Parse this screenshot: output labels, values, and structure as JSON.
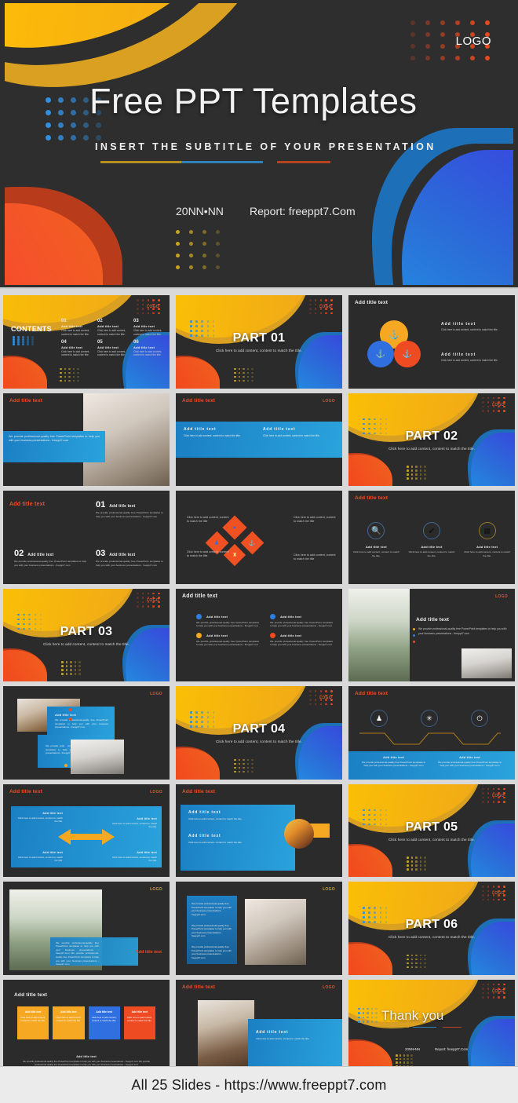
{
  "hero": {
    "logo": "LOGO",
    "title": "Free PPT Templates",
    "subtitle": "INSERT THE SUBTITLE OF YOUR PRESENTATION",
    "date": "20NN•NN",
    "report": "Report:  freeppt7.Com"
  },
  "footer": {
    "text": "All 25 Slides - https://www.freeppt7.com"
  },
  "common": {
    "add_title": "Add title text",
    "logo": "LOGO",
    "click_content": "Click here to add content, content to match the title.",
    "body_short": "Click here to add content, content to match the title.",
    "body_long": "We provide professional-quality free PowerPoint templates to help you with your business presentations - freeppt7.com"
  },
  "slides": [
    {
      "n": 1,
      "name": "contents",
      "title": "CONTENTS",
      "logo": "LOGO",
      "items": [
        {
          "num": "01",
          "label": "Add title text",
          "body": "Click here to add content, content to match the title."
        },
        {
          "num": "02",
          "label": "Add title text",
          "body": "Click here to add content, content to match the title."
        },
        {
          "num": "03",
          "label": "Add title text",
          "body": "Click here to add content, content to match the title."
        },
        {
          "num": "04",
          "label": "Add title text",
          "body": "Click here to add content, content to match the title."
        },
        {
          "num": "05",
          "label": "Add title text",
          "body": "Click here to add content, content to match the title."
        },
        {
          "num": "06",
          "label": "Add title text",
          "body": "Click here to add content, content to match the title."
        }
      ]
    },
    {
      "n": 2,
      "name": "part-01",
      "heading": "PART 01",
      "sub": "Click here to add content, content to match the title.",
      "logo": "LOGO"
    },
    {
      "n": 3,
      "name": "venn-anchors",
      "title": "Add title text",
      "blocks": [
        {
          "label": "Add  title  text",
          "body": "Click here to add content, content to match the title."
        },
        {
          "label": "Add  title  text",
          "body": "Click here to add content, content to match the title."
        }
      ]
    },
    {
      "n": 4,
      "name": "laptop-photo-caption",
      "title": "Add title text",
      "body": "We provide professional-quality free PowerPoint templates to help you with your business presentations - freeppt7.com"
    },
    {
      "n": 5,
      "name": "two-column-blue",
      "title": "Add title text",
      "logo": "LOGO",
      "blocks": [
        {
          "label": "Add  title  text",
          "body": "Click here to add content, content to match the title."
        },
        {
          "label": "Add  title  text",
          "body": "Click here to add content, content to match the title."
        }
      ]
    },
    {
      "n": 6,
      "name": "part-02",
      "heading": "PART 02",
      "sub": "Click here to add content, content to match the title.",
      "logo": "LOGO"
    },
    {
      "n": 7,
      "name": "numbered-three",
      "title": "Add title  text",
      "items": [
        {
          "num": "01",
          "label": "Add title text",
          "body": "We provide professional-quality free PowerPoint templates to help you with your business presentations - freeppt7.com"
        },
        {
          "num": "02",
          "label": "Add title text",
          "body": "We provide professional-quality free PowerPoint templates to help you with your business presentations - freeppt7.com"
        },
        {
          "num": "03",
          "label": "Add title text",
          "body": "We provide professional-quality free PowerPoint templates to help you with your business presentations - freeppt7.com"
        }
      ]
    },
    {
      "n": 8,
      "name": "diamond-cluster",
      "notes": [
        "Click here to add content, content to match the title",
        "Click here to add content, content to match the title",
        "Click here to add content, content to match the title",
        "Click here to add content, content to match the title"
      ]
    },
    {
      "n": 9,
      "name": "three-icon-rings",
      "title": "Add title  text",
      "items": [
        {
          "icon": "search-icon",
          "label": "Add title text",
          "body": "Click here to add content, content to match the title."
        },
        {
          "icon": "check-icon",
          "label": "Add title text",
          "body": "Click here to add content, content to match the title."
        },
        {
          "icon": "grid-icon",
          "label": "Add title text",
          "body": "Click here to add content, content to match the title."
        }
      ]
    },
    {
      "n": 10,
      "name": "part-03",
      "heading": "PART 03",
      "sub": "Click here to add content, content to match the title.",
      "logo": "LOGO"
    },
    {
      "n": 11,
      "name": "four-bullet-grid",
      "title": "Add title  text",
      "items": [
        {
          "color": "#2f7fe0",
          "label": "Add title text",
          "body": "We provide professional-quality free PowerPoint templates to help you with your business presentations - freeppt7.com"
        },
        {
          "color": "#2f7fe0",
          "label": "Add title text",
          "body": "We provide professional-quality free PowerPoint templates to help you with your business presentations - freeppt7.com"
        },
        {
          "color": "#f7a823",
          "label": "Add title text",
          "body": "We provide professional-quality free PowerPoint templates to help you with your business presentations - freeppt7.com"
        },
        {
          "color": "#ef4b23",
          "label": "Add title text",
          "body": "We provide professional-quality free PowerPoint templates to help you with your business presentations - freeppt7.com"
        }
      ]
    },
    {
      "n": 12,
      "name": "photo-left-bullets",
      "title": "Add title text",
      "logo": "LOGO",
      "body": "We provide professional-quality free PowerPoint templates to help you with your business presentations - freeppt7.com"
    },
    {
      "n": 13,
      "name": "overlap-photo-cards",
      "logo": "LOGO",
      "cards": [
        {
          "label": "Add title text",
          "body": "We provide professional-quality free PowerPoint templates to help you with your business presentations - freeppt7.com"
        },
        {
          "label": "Add title text",
          "body": "We provide professional-quality free PowerPoint templates to help you with your business presentations - freeppt7.com"
        }
      ]
    },
    {
      "n": 14,
      "name": "part-04",
      "heading": "PART 04",
      "sub": "Click here to add content, content to match the title.",
      "logo": "LOGO"
    },
    {
      "n": 15,
      "name": "timeline-icons",
      "title": "Add title  text",
      "items": [
        {
          "icon": "user-icon",
          "label": "Add title text",
          "body": "We provide professional-quality free PowerPoint templates to help you with your business presentations - freeppt7.com"
        },
        {
          "icon": "sun-icon",
          "label": "Add title text",
          "body": "We provide professional-quality free PowerPoint templates to help you with your business presentations - freeppt7.com"
        },
        {
          "icon": "power-icon",
          "label": "",
          "body": ""
        }
      ]
    },
    {
      "n": 16,
      "name": "double-arrow-quad",
      "title": "Add title text",
      "logo": "LOGO",
      "quads": [
        {
          "label": "Add title text",
          "body": "Click here to add content, content to match the title."
        },
        {
          "label": "Add title text",
          "body": "Click here to add content, content to match the title."
        },
        {
          "label": "Add title text",
          "body": "Click here to add content, content to match the title."
        },
        {
          "label": "Add title text",
          "body": "Click here to add content, content to match the title."
        }
      ]
    },
    {
      "n": 17,
      "name": "blue-panel-circle-photo",
      "title": "Add title text",
      "blocks": [
        {
          "label": "Add  title  text",
          "body": "Click here to add content, content to match the title."
        },
        {
          "label": "Add  title  text",
          "body": "Click here to add content, content to match the title."
        }
      ]
    },
    {
      "n": 18,
      "name": "part-05",
      "heading": "PART 05",
      "sub": "Click here to add content, content to match the title.",
      "logo": "LOGO"
    },
    {
      "n": 19,
      "name": "photo-caption-overlay",
      "logo": "LOGO",
      "title": "Add title  text",
      "body": "We provide professional-quality free PowerPoint templates to help you with your business presentations - freeppt7.com We provide professional-quality free PowerPoint templates to help you with your business presentations - freeppt7.com"
    },
    {
      "n": 20,
      "name": "blue-text-photo",
      "logo": "LOGO",
      "paras": [
        "We provide professional-quality free PowerPoint templates to help you with your business presentations - freeppt7.com",
        "We provide professional-quality free PowerPoint templates to help you with your business presentations - freeppt7.com",
        "We provide professional-quality free PowerPoint templates to help you with your business presentations - freeppt7.com"
      ]
    },
    {
      "n": 21,
      "name": "part-06",
      "heading": "PART 06",
      "sub": "Click here to add content, content to match the title.",
      "logo": "LOGO"
    },
    {
      "n": 22,
      "name": "four-color-cards",
      "title": "Add title  text",
      "cards": [
        {
          "color": "#f7a823",
          "label": "Add title text",
          "body": "Click here to add content, content to match the title."
        },
        {
          "color": "#f7a823",
          "label": "Add title text",
          "body": "Click here to add content, content to match the title."
        },
        {
          "color": "#2f6fe0",
          "label": "Add title text",
          "body": "Click here to add content, content to match the title."
        },
        {
          "color": "#ef4b23",
          "label": "Add title text",
          "body": "Click here to add content, content to match the title."
        }
      ],
      "footer_label": "Add title text",
      "footer_body": "We provide professional-quality free PowerPoint templates to help you with your business presentations - freeppt7.com We provide professional-quality free PowerPoint templates to help you with your business presentations - freeppt7.com"
    },
    {
      "n": 23,
      "name": "photo-right-panel",
      "title": "Add title text",
      "logo": "LOGO",
      "block": {
        "label": "Add  title  text",
        "body": "Click here to add content, content to match the title."
      }
    },
    {
      "n": 24,
      "name": "thank-you",
      "heading": "Thank you",
      "logo": "LOGO",
      "date": "20NN•NN",
      "report": "Report:  freeppt7.Com"
    }
  ]
}
